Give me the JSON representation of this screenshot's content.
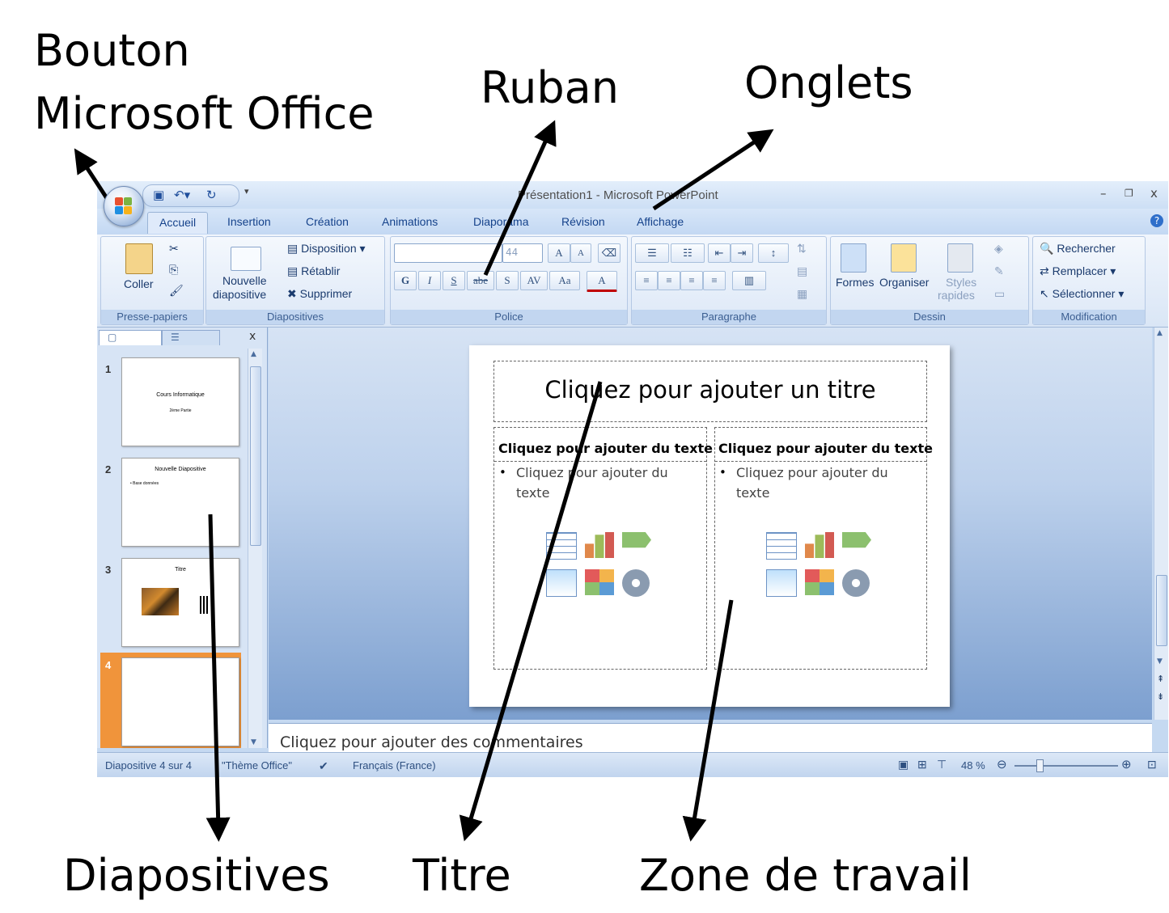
{
  "callouts": {
    "bouton_line1": "Bouton",
    "bouton_line2": "Microsoft Office",
    "ruban": "Ruban",
    "onglets": "Onglets",
    "diapositives": "Diapositives",
    "titre": "Titre",
    "zone": "Zone de travail"
  },
  "window": {
    "title": "Présentation1 - Microsoft PowerPoint",
    "minimize": "–",
    "restore": "❐",
    "close": "x"
  },
  "qat": {
    "save_icon": "save-icon",
    "undo_icon": "undo-icon",
    "redo_icon": "redo-icon"
  },
  "tabs": [
    "Accueil",
    "Insertion",
    "Création",
    "Animations",
    "Diaporama",
    "Révision",
    "Affichage"
  ],
  "ribbon": {
    "clipboard": {
      "paste": "Coller",
      "label": "Presse-papiers"
    },
    "slides": {
      "new_slide_1": "Nouvelle",
      "new_slide_2": "diapositive",
      "layout": "Disposition",
      "reset": "Rétablir",
      "delete": "Supprimer",
      "label": "Diapositives"
    },
    "font": {
      "size": "44",
      "bold": "G",
      "italic": "I",
      "underline": "S",
      "strike": "abe",
      "shadow": "S",
      "spacing": "AV",
      "case": "Aa",
      "color": "A",
      "grow": "A",
      "shrink": "A",
      "label": "Police"
    },
    "paragraph": {
      "label": "Paragraphe"
    },
    "drawing": {
      "shapes": "Formes",
      "arrange": "Organiser",
      "styles_1": "Styles",
      "styles_2": "rapides",
      "label": "Dessin"
    },
    "editing": {
      "find": "Rechercher",
      "replace": "Remplacer",
      "select": "Sélectionner",
      "label": "Modification"
    }
  },
  "panel": {
    "close": "x",
    "slides": [
      {
        "num": "1",
        "title": "Cours Informatique",
        "sub": "2ème Partie"
      },
      {
        "num": "2",
        "title": "Nouvelle Diapositive",
        "sub": "• Base données"
      },
      {
        "num": "3",
        "title": "Titre",
        "sub": ""
      },
      {
        "num": "4",
        "title": "",
        "sub": ""
      }
    ]
  },
  "slide": {
    "title": "Cliquez pour ajouter un titre",
    "left_header": "Cliquez pour ajouter du texte",
    "left_bullet_1": "Cliquez pour ajouter du",
    "left_bullet_2": "texte",
    "right_header": "Cliquez pour ajouter du texte",
    "right_bullet_1": "Cliquez pour ajouter du",
    "right_bullet_2": "texte",
    "bullet": "•"
  },
  "notes": {
    "placeholder": "Cliquez pour ajouter des commentaires"
  },
  "status": {
    "slide": "Diapositive 4 sur 4",
    "theme": "\"Thème Office\"",
    "language": "Français (France)",
    "zoom": "48 %",
    "zoom_value": 0.48
  },
  "colors": {
    "accent": "#15428b",
    "ribbon": "#dae6f6",
    "selected_thumb": "#f0943b"
  }
}
